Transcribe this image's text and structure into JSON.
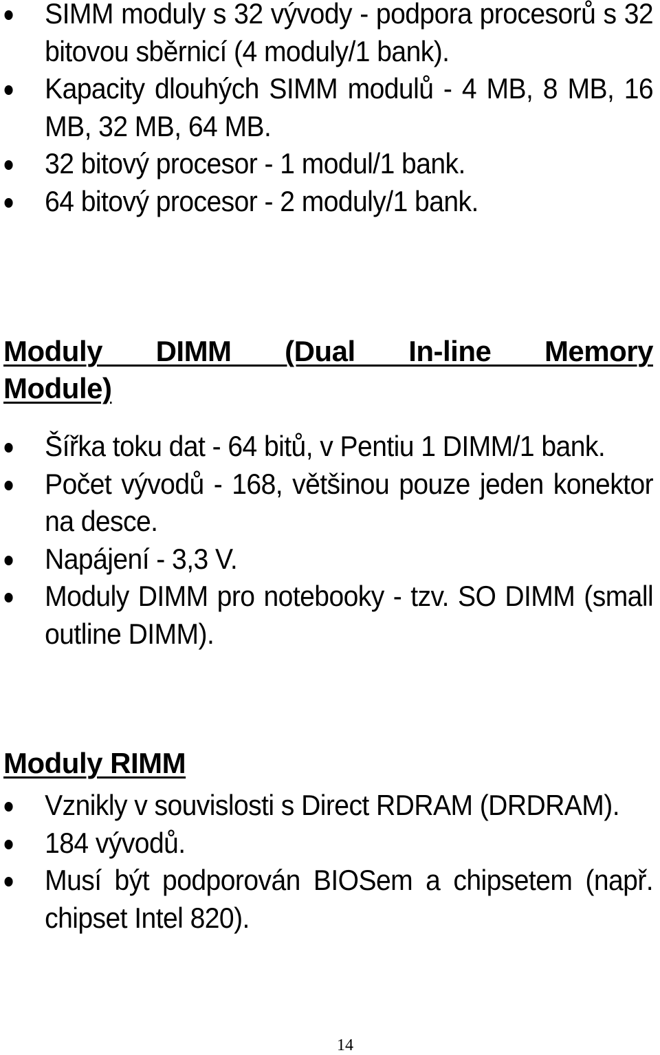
{
  "sections": [
    {
      "heading": null,
      "items": [
        "SIMM moduly s 32 vývody - podpora procesorů s 32 bitovou sběrnicí (4 moduly/1 bank).",
        "Kapacity dlouhých SIMM modulů - 4 MB, 8 MB, 16 MB, 32 MB, 64 MB.",
        "32 bitový procesor - 1 modul/1 bank.",
        "64 bitový procesor - 2 moduly/1 bank."
      ]
    },
    {
      "heading": "Moduly DIMM (Dual In-line Memory Module)",
      "heading_lines": [
        "Moduly DIMM (Dual In-line Memory",
        "Module)"
      ],
      "items": [
        "Šířka toku dat - 64 bitů, v Pentiu 1 DIMM/1 bank.",
        "Počet vývodů - 168, většinou pouze jeden konektor na desce.",
        "Napájení - 3,3 V.",
        "Moduly DIMM pro notebooky - tzv. SO DIMM (small outline DIMM)."
      ]
    },
    {
      "heading": "Moduly RIMM",
      "items": [
        "Vznikly v souvislosti s Direct RDRAM (DRDRAM).",
        "184 vývodů.",
        "Musí být podporován BIOSem a chipsetem (např. chipset Intel 820)."
      ]
    }
  ],
  "footer": {
    "page_number": "14"
  }
}
